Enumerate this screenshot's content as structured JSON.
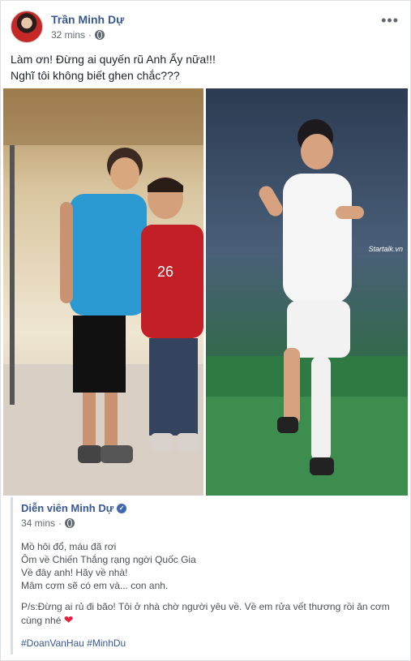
{
  "post": {
    "author": "Trần Minh Dự",
    "time": "32 mins",
    "text_lines": [
      "Làm ơn! Đừng ai quyến rũ Anh Ấy nữa!!!",
      "Nghĩ tôi không biết ghen chắc???"
    ],
    "more_icon": "more-options-icon",
    "privacy_icon": "globe-icon"
  },
  "photos": {
    "right_watermark": "Startalk.vn",
    "jersey_number": "26"
  },
  "shared": {
    "author": "Diễn viên Minh Dự",
    "time": "34 mins",
    "lines": [
      "Mồ hôi đổ, máu đã rơi",
      "Ôm về Chiến Thắng rạng ngời Quốc Gia",
      "Về đây anh! Hãy về nhà!",
      "Mâm cơm sẽ có em và... con anh."
    ],
    "ps_text": "P/s:Đừng ai rủ đi bão! Tôi ở nhà chờ người yêu về. Về em rửa vết thương rồi ăn cơm cùng nhé",
    "hashtags": [
      "#DoanVanHau",
      "#MinhDu"
    ]
  },
  "colors": {
    "link": "#385898",
    "heart": "#e41e3f"
  }
}
